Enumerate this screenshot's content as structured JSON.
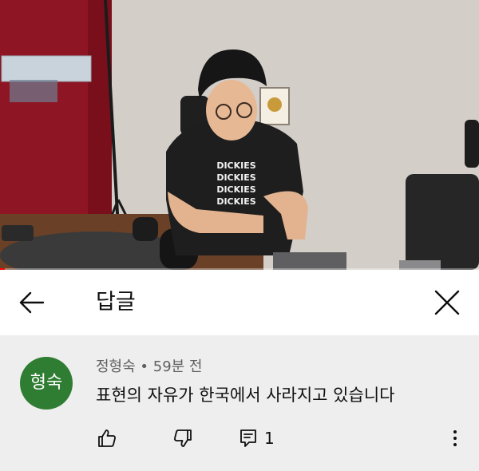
{
  "video": {
    "shirt_text": "DICKIES",
    "progress": 0.01
  },
  "header": {
    "title": "답글",
    "back_icon": "arrow-left-icon",
    "close_icon": "close-icon"
  },
  "comment": {
    "avatar_text": "형숙",
    "avatar_color": "#2f7d32",
    "author": "정형숙",
    "separator": " • ",
    "time": "59분 전",
    "text": "표현의 자유가 한국에서 사라지고 있습니다",
    "reply_count": "1",
    "icons": [
      "thumb-up-icon",
      "thumb-down-icon",
      "reply-icon",
      "more-vertical-icon"
    ]
  }
}
